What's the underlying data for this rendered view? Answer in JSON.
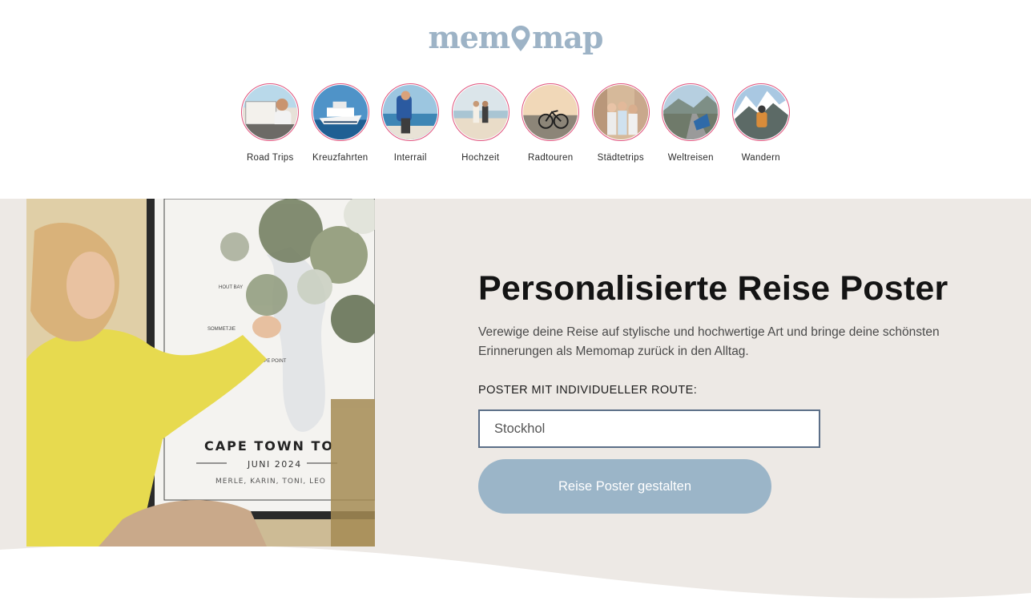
{
  "brand": {
    "logo_text_before": "mem",
    "logo_text_after": "map",
    "accent": "#9db3c6"
  },
  "categories": [
    {
      "label": "Road Trips",
      "icon": "road-trip-photo"
    },
    {
      "label": "Kreuzfahrten",
      "icon": "cruise-photo"
    },
    {
      "label": "Interrail",
      "icon": "interrail-photo"
    },
    {
      "label": "Hochzeit",
      "icon": "wedding-photo"
    },
    {
      "label": "Radtouren",
      "icon": "bike-photo"
    },
    {
      "label": "Städtetrips",
      "icon": "city-trip-photo"
    },
    {
      "label": "Weltreisen",
      "icon": "world-travel-photo"
    },
    {
      "label": "Wandern",
      "icon": "hiking-photo"
    }
  ],
  "hero": {
    "title": "Personalisierte Reise Poster",
    "description": "Verewige deine Reise auf stylische und hochwertige Art und bringe deine schönsten Erinnerungen als Memomap zurück in den Alltag.",
    "route_label": "POSTER MIT INDIVIDUELLER ROUTE:",
    "route_input_value": "Stockhol",
    "cta_label": "Reise Poster gestalten",
    "background": "#ede9e5",
    "cta_color": "#9bb5c8",
    "poster": {
      "title": "CAPE TOWN TO",
      "date": "JUNI 2024",
      "names": "MERLE, KARIN, TONI, LEO",
      "map_labels": [
        "HOUT BAY",
        "SOMMETJIE",
        "CAPE POINT"
      ]
    }
  }
}
